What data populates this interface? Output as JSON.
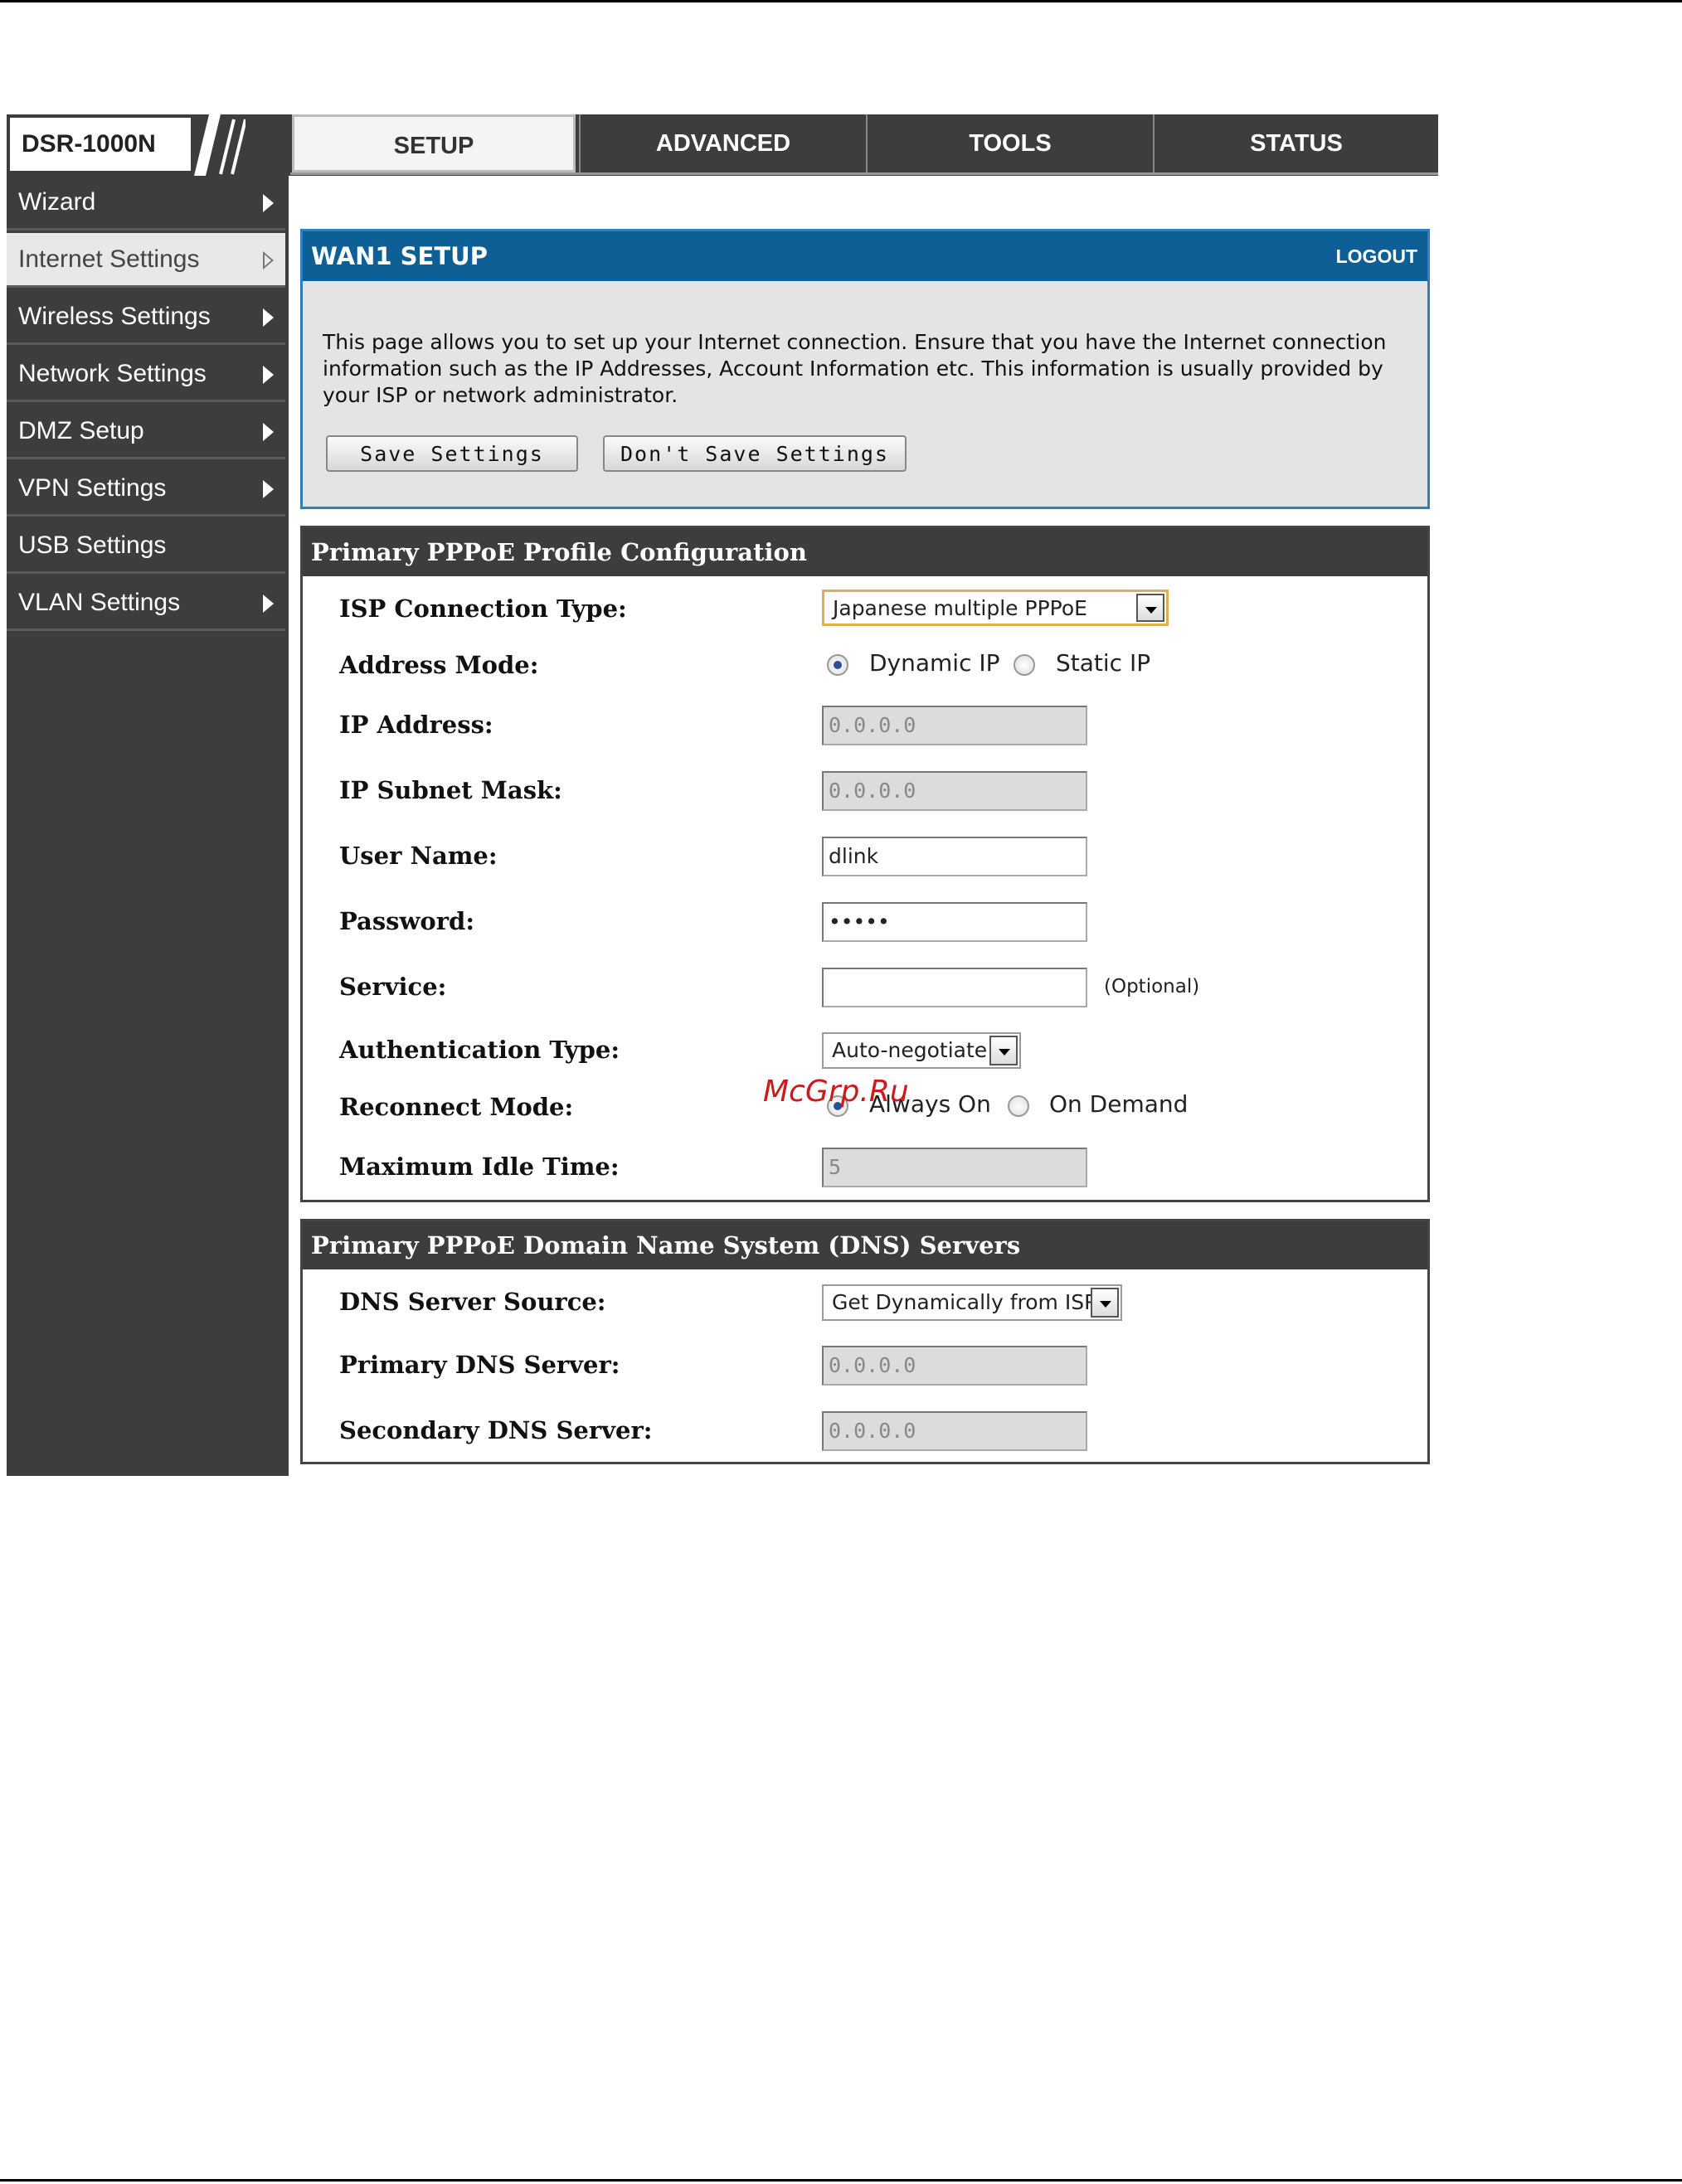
{
  "brand": {
    "model": "DSR-1000N"
  },
  "tabs": [
    {
      "label": "SETUP",
      "active": true
    },
    {
      "label": "ADVANCED"
    },
    {
      "label": "TOOLS"
    },
    {
      "label": "STATUS"
    }
  ],
  "sidebar": {
    "items": [
      {
        "label": "Wizard",
        "arrow": true
      },
      {
        "label": "Internet Settings",
        "arrow": true,
        "active": true
      },
      {
        "label": "Wireless Settings",
        "arrow": true
      },
      {
        "label": "Network Settings",
        "arrow": true
      },
      {
        "label": "DMZ Setup",
        "arrow": true
      },
      {
        "label": "VPN Settings",
        "arrow": true
      },
      {
        "label": "USB Settings",
        "arrow": false
      },
      {
        "label": "VLAN Settings",
        "arrow": true
      }
    ]
  },
  "wan": {
    "title": "WAN1 SETUP",
    "logout": "LOGOUT",
    "description": "This page allows you to set up your Internet connection. Ensure that you have the Internet connection information such as the IP Addresses, Account Information etc. This information is usually provided by your ISP or network administrator.",
    "save_label": "Save Settings",
    "dont_save_label": "Don't Save Settings"
  },
  "pppoe": {
    "title": "Primary PPPoE Profile Configuration",
    "isp_type": {
      "label": "ISP Connection Type:",
      "value": "Japanese multiple PPPoE"
    },
    "address_mode": {
      "label": "Address Mode:",
      "options": [
        "Dynamic IP",
        "Static IP"
      ],
      "selected": "Dynamic IP"
    },
    "ip_address": {
      "label": "IP Address:",
      "value": "0.0.0.0"
    },
    "subnet": {
      "label": "IP Subnet Mask:",
      "value": "0.0.0.0"
    },
    "username": {
      "label": "User Name:",
      "value": "dlink"
    },
    "password": {
      "label": "Password:",
      "value": "•••••"
    },
    "service": {
      "label": "Service:",
      "value": "",
      "hint": "(Optional)"
    },
    "auth": {
      "label": "Authentication Type:",
      "value": "Auto-negotiate"
    },
    "reconnect": {
      "label": "Reconnect Mode:",
      "options": [
        "Always On",
        "On Demand"
      ],
      "selected": "Always On"
    },
    "idle": {
      "label": "Maximum Idle Time:",
      "value": "5"
    }
  },
  "dns": {
    "title": "Primary PPPoE Domain Name System (DNS) Servers",
    "source": {
      "label": "DNS Server Source:",
      "value": "Get Dynamically from ISP"
    },
    "primary": {
      "label": "Primary DNS Server:",
      "value": "0.0.0.0"
    },
    "secondary": {
      "label": "Secondary DNS Server:",
      "value": "0.0.0.0"
    }
  },
  "watermark": "McGrp.Ru"
}
